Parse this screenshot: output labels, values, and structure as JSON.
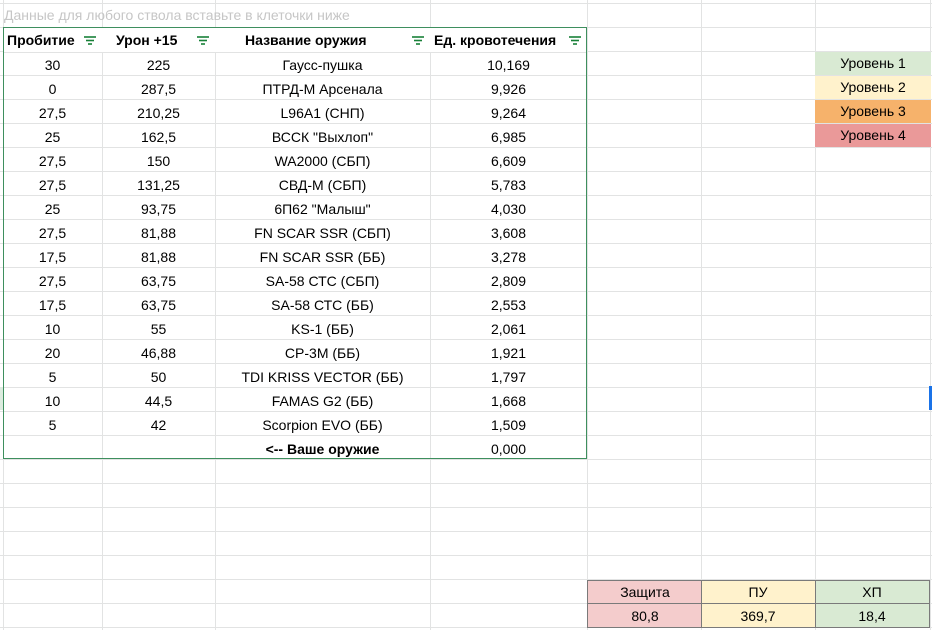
{
  "hint_text": "Данные для любого ствола вставьте  в клеточки ниже",
  "headers": [
    "Пробитие",
    "Урон +15",
    "Название оружия",
    "Ед. кровотечения"
  ],
  "rows": [
    {
      "pen": "30",
      "dmg": "225",
      "name": "Гаусс-пушка",
      "bleed": "10,169"
    },
    {
      "pen": "0",
      "dmg": "287,5",
      "name": "ПТРД-М Арсенала",
      "bleed": "9,926"
    },
    {
      "pen": "27,5",
      "dmg": "210,25",
      "name": "L96A1 (СНП)",
      "bleed": "9,264"
    },
    {
      "pen": "25",
      "dmg": "162,5",
      "name": "ВССК \"Выхлоп\"",
      "bleed": "6,985"
    },
    {
      "pen": "27,5",
      "dmg": "150",
      "name": "WA2000 (СБП)",
      "bleed": "6,609"
    },
    {
      "pen": "27,5",
      "dmg": "131,25",
      "name": "СВД-М (СБП)",
      "bleed": "5,783"
    },
    {
      "pen": "25",
      "dmg": "93,75",
      "name": "6П62 \"Малыш\"",
      "bleed": "4,030"
    },
    {
      "pen": "27,5",
      "dmg": "81,88",
      "name": "FN SCAR SSR (СБП)",
      "bleed": "3,608"
    },
    {
      "pen": "17,5",
      "dmg": "81,88",
      "name": "FN SCAR SSR (ББ)",
      "bleed": "3,278"
    },
    {
      "pen": "27,5",
      "dmg": "63,75",
      "name": "SA-58 СТС (СБП)",
      "bleed": "2,809"
    },
    {
      "pen": "17,5",
      "dmg": "63,75",
      "name": "SA-58 СТС (ББ)",
      "bleed": "2,553"
    },
    {
      "pen": "10",
      "dmg": "55",
      "name": "KS-1 (ББ)",
      "bleed": "2,061"
    },
    {
      "pen": "20",
      "dmg": "46,88",
      "name": "СР-3М (ББ)",
      "bleed": "1,921"
    },
    {
      "pen": "5",
      "dmg": "50",
      "name": "TDI KRISS VECTOR (ББ)",
      "bleed": "1,797"
    },
    {
      "pen": "10",
      "dmg": "44,5",
      "name": "FAMAS G2 (ББ)",
      "bleed": "1,668"
    },
    {
      "pen": "5",
      "dmg": "42",
      "name": "Scorpion EVO (ББ)",
      "bleed": "1,509"
    },
    {
      "pen": "",
      "dmg": "",
      "name": "<-- Ваше оружие",
      "bleed": "0,000",
      "bold_name": true
    }
  ],
  "levels": [
    {
      "label": "Уровень 1",
      "color": "#d9ead3"
    },
    {
      "label": "Уровень 2",
      "color": "#fff2cc"
    },
    {
      "label": "Уровень 3",
      "color": "#f6b26b"
    },
    {
      "label": "Уровень 4",
      "color": "#ea9999"
    }
  ],
  "stats": {
    "labels": [
      "Защита",
      "ПУ",
      "ХП"
    ],
    "values": [
      "80,8",
      "369,7",
      "18,4"
    ],
    "colors": [
      "#f4cccc",
      "#fff2cc",
      "#d9ead3"
    ]
  },
  "colors": {
    "grid": "#e2e3e3",
    "table_border": "#3e8f5e",
    "filter_icon": "#188038",
    "selection": "#1a73e8"
  },
  "icons": {
    "filter": "filter-icon"
  }
}
